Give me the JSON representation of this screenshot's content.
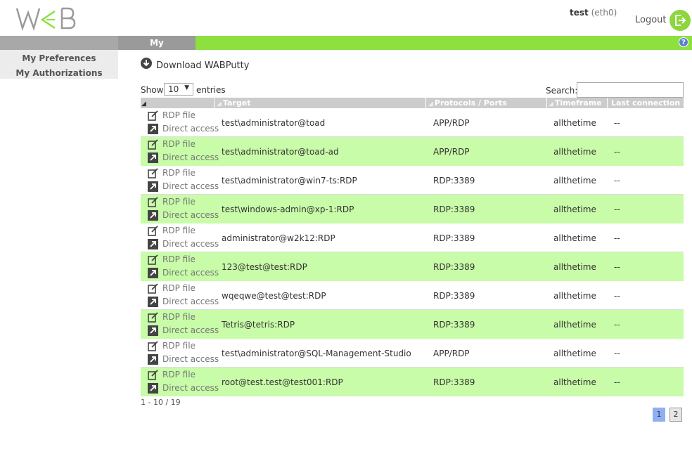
{
  "header": {
    "logo_text": "WAB",
    "username": "test",
    "interface": "(eth0)",
    "logout_label": "Logout"
  },
  "nav": {
    "active_tab": "My authorizations",
    "help_symbol": "?"
  },
  "sidebar": {
    "items": [
      {
        "label": "My Preferences"
      },
      {
        "label": "My Authorizations"
      }
    ]
  },
  "download": {
    "label": "Download WABPutty"
  },
  "controls": {
    "show_label": "Show",
    "entries_value": "10",
    "entries_label": "entries",
    "search_label": "Search:",
    "search_value": ""
  },
  "table": {
    "columns": [
      "Target",
      "Protocols / Ports",
      "Timeframe",
      "Last connection"
    ],
    "action_rdp": "RDP file",
    "action_direct": "Direct access",
    "rows": [
      {
        "target": "test\\administrator@toad",
        "protocol": "APP/RDP",
        "timeframe": "allthetime",
        "last": "--"
      },
      {
        "target": "test\\administrator@toad-ad",
        "protocol": "APP/RDP",
        "timeframe": "allthetime",
        "last": "--"
      },
      {
        "target": "test\\administrator@win7-ts:RDP",
        "protocol": "RDP:3389",
        "timeframe": "allthetime",
        "last": "--"
      },
      {
        "target": "test\\windows-admin@xp-1:RDP",
        "protocol": "RDP:3389",
        "timeframe": "allthetime",
        "last": "--"
      },
      {
        "target": "administrator@w2k12:RDP",
        "protocol": "RDP:3389",
        "timeframe": "allthetime",
        "last": "--"
      },
      {
        "target": "123@test@test:RDP",
        "protocol": "RDP:3389",
        "timeframe": "allthetime",
        "last": "--"
      },
      {
        "target": "wqeqwe@test@test:RDP",
        "protocol": "RDP:3389",
        "timeframe": "allthetime",
        "last": "--"
      },
      {
        "target": "Tetris@tetris:RDP",
        "protocol": "RDP:3389",
        "timeframe": "allthetime",
        "last": "--"
      },
      {
        "target": "test\\administrator@SQL-Management-Studio",
        "protocol": "APP/RDP",
        "timeframe": "allthetime",
        "last": "--"
      },
      {
        "target": "root@test.test@test001:RDP",
        "protocol": "RDP:3389",
        "timeframe": "allthetime",
        "last": "--"
      }
    ]
  },
  "pagination": {
    "summary": "1 - 10 / 19",
    "pages": [
      "1",
      "2"
    ],
    "current": "1"
  },
  "colors": {
    "accent_green": "#8ee03f",
    "row_highlight": "#c8fca8",
    "header_gray": "#cccccc",
    "page_active": "#8fb0f0"
  }
}
